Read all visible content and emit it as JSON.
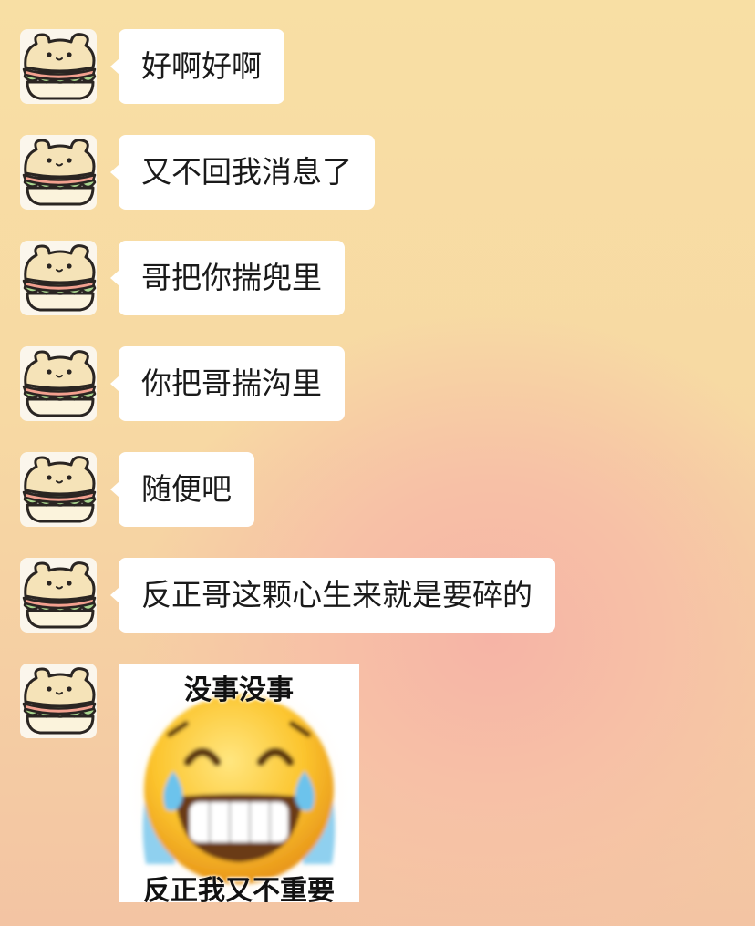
{
  "chat": {
    "messages": [
      {
        "text": "好啊好啊"
      },
      {
        "text": "又不回我消息了"
      },
      {
        "text": "哥把你揣兜里"
      },
      {
        "text": "你把哥揣沟里"
      },
      {
        "text": "随便吧"
      },
      {
        "text": "反正哥这颗心生来就是要碎的"
      }
    ],
    "sticker": {
      "top_text": "没事没事",
      "bottom_text": "反正我又不重要",
      "icon": "crying-laughing-face-icon"
    },
    "avatar_icon": "sandwich-bear-avatar-icon"
  },
  "colors": {
    "bubble": "#ffffff",
    "background_top": "#f8dfa4",
    "background_glow": "#f6b4a6"
  }
}
